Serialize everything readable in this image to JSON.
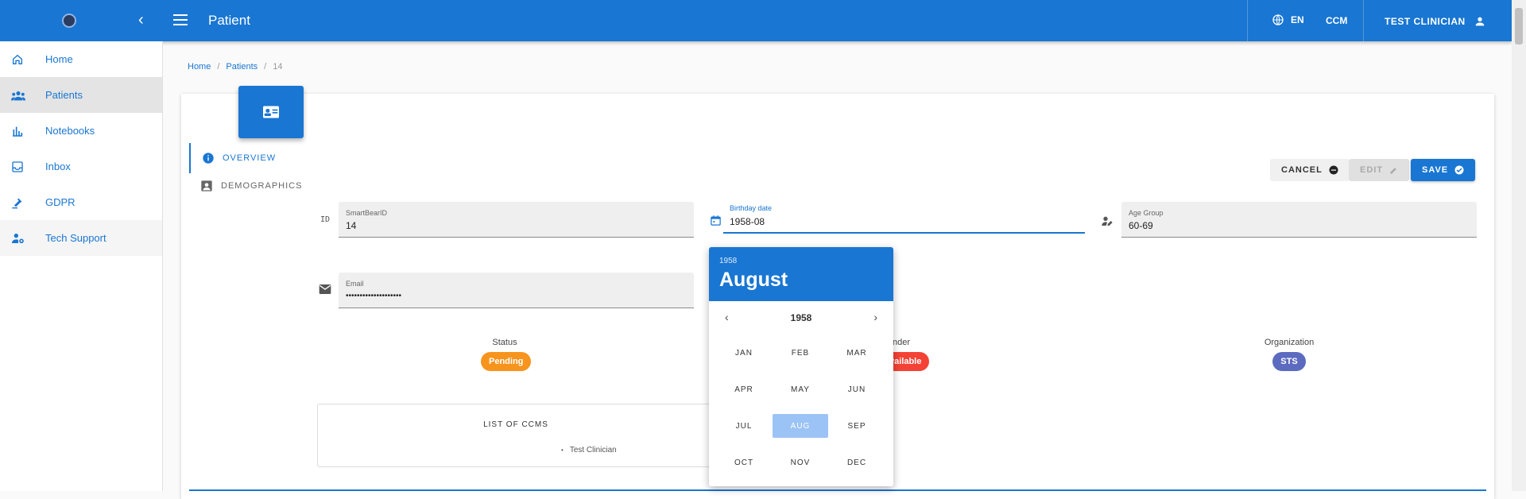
{
  "appbar": {
    "title": "Patient",
    "language": "EN",
    "ccm": "CCM",
    "user": "TEST CLINICIAN"
  },
  "sidebar": {
    "items": [
      {
        "label": "Home",
        "icon": "home-icon"
      },
      {
        "label": "Patients",
        "icon": "people-icon"
      },
      {
        "label": "Notebooks",
        "icon": "bar-chart-icon"
      },
      {
        "label": "Inbox",
        "icon": "inbox-icon"
      },
      {
        "label": "GDPR",
        "icon": "gavel-icon"
      },
      {
        "label": "Tech Support",
        "icon": "support-icon"
      }
    ]
  },
  "breadcrumb": {
    "home": "Home",
    "patients": "Patients",
    "current": "14"
  },
  "tabs": {
    "overview": "OVERVIEW",
    "demographics": "DEMOGRAPHICS"
  },
  "buttons": {
    "cancel": "CANCEL",
    "edit": "EDIT",
    "save": "SAVE"
  },
  "fields": {
    "id_prefix": "ID",
    "smartbear_label": "SmartBearID",
    "smartbear_value": "14",
    "birthday_label": "Birthday date",
    "birthday_value": "1958-08",
    "agegroup_label": "Age Group",
    "agegroup_value": "60-69",
    "email_label": "Email",
    "email_value": "••••••••••••••••••••"
  },
  "status": {
    "label": "Status",
    "value": "Pending",
    "color": "#f7941d"
  },
  "gender": {
    "label": "nder",
    "value": "vailable",
    "color": "#f44336"
  },
  "organization": {
    "label": "Organization",
    "value": "STS",
    "color": "#5c6bc0"
  },
  "ccms": {
    "header": "LIST OF CCMS",
    "items": [
      "Test Clinician"
    ]
  },
  "picker": {
    "year": "1958",
    "month": "August",
    "nav_year": "1958",
    "months": [
      "JAN",
      "FEB",
      "MAR",
      "APR",
      "MAY",
      "JUN",
      "JUL",
      "AUG",
      "SEP",
      "OCT",
      "NOV",
      "DEC"
    ],
    "selected": "AUG"
  },
  "colors": {
    "primary": "#1976d2"
  }
}
